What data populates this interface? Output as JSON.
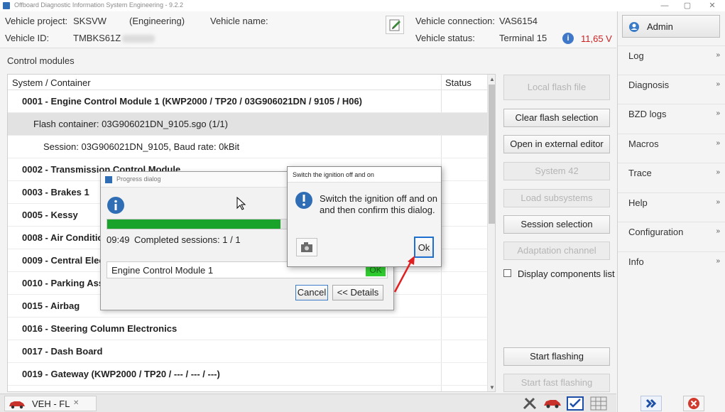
{
  "window": {
    "title": "Offboard Diagnostic Information System Engineering - 9.2.2",
    "controls": [
      "—",
      "▢",
      "✕"
    ]
  },
  "header": {
    "vehicle_project_label": "Vehicle project:",
    "vehicle_project_value": "SKSVW",
    "engineering": "(Engineering)",
    "vehicle_name_label": "Vehicle name:",
    "vehicle_name_value": "",
    "vehicle_id_label": "Vehicle ID:",
    "vehicle_id_value": "TMBKS61Z",
    "vehicle_connection_label": "Vehicle connection:",
    "vehicle_connection_value": "VAS6154",
    "vehicle_status_label": "Vehicle status:",
    "vehicle_status_value": "Terminal 15",
    "voltage": "11,65 V",
    "voltage_color": "#d02020"
  },
  "sidebar": {
    "admin_label": "Admin",
    "items": [
      {
        "label": "Log"
      },
      {
        "label": "Diagnosis"
      },
      {
        "label": "BZD logs"
      },
      {
        "label": "Macros"
      },
      {
        "label": "Trace"
      },
      {
        "label": "Help"
      },
      {
        "label": "Configuration"
      },
      {
        "label": "Info"
      }
    ],
    "chevron": "»"
  },
  "control_modules": {
    "title": "Control modules",
    "col_system": "System / Container",
    "col_status": "Status",
    "rows": [
      {
        "text": "0001 - Engine Control Module 1  (KWP2000 / TP20 / 03G906021DN / 9105 / H06)"
      },
      {
        "text": "Flash container: 03G906021DN_9105.sgo (1/1)"
      },
      {
        "text": "Session: 03G906021DN_9105, Baud rate: 0kBit"
      },
      {
        "text": "0002 - Transmission Control Module"
      },
      {
        "text": "0003 - Brakes 1"
      },
      {
        "text": "0005 - Kessy"
      },
      {
        "text": "0008 - Air Conditio"
      },
      {
        "text": "0009 - Central Elec"
      },
      {
        "text": "0010 - Parking Ass"
      },
      {
        "text": "0015 - Airbag"
      },
      {
        "text": "0016 - Steering Column Electronics"
      },
      {
        "text": "0017 - Dash Board"
      },
      {
        "text": "0019 - Gateway  (KWP2000 / TP20 / --- / --- / ---)"
      }
    ]
  },
  "actions": {
    "local_flash_file": "Local flash file",
    "clear_flash_selection": "Clear flash selection",
    "open_external_editor": "Open in external editor",
    "system_42": "System 42",
    "load_subsystems": "Load subsystems",
    "session_selection": "Session selection",
    "adaptation_channel": "Adaptation channel",
    "display_components_list": "Display components list",
    "start_flashing": "Start flashing",
    "start_fast_flashing": "Start fast flashing"
  },
  "bottom": {
    "tab_label": "VEH - FL",
    "tab_close": "✕"
  },
  "progress_dialog": {
    "title": "Progress dialog",
    "progress": 0.62,
    "time": "09:49",
    "completed": "Completed sessions: 1 / 1",
    "module_name": "Engine Control Module 1",
    "module_status": "OK",
    "cancel": "Cancel",
    "details": "<< Details"
  },
  "switch_dialog": {
    "title": "Switch the ignition off and on",
    "message_line1": "Switch the ignition off and on",
    "message_line2": "and then confirm this dialog.",
    "ok": "Ok"
  }
}
